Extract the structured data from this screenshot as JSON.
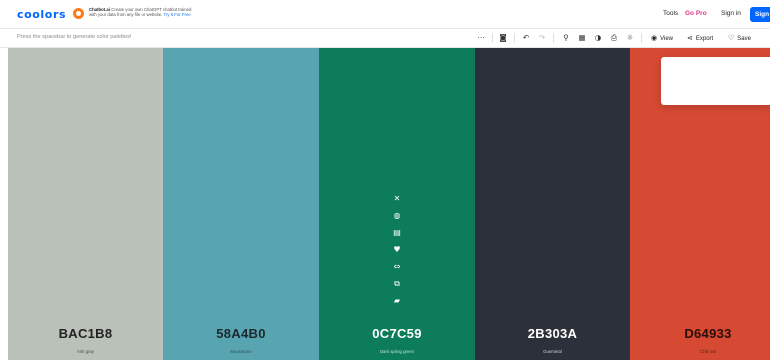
{
  "nav": {
    "logo": "coolors",
    "ad": {
      "brand": "Chatbot.ai",
      "line1": "Create your own ChatGPT chatbot trained",
      "line2": "with your data from any file or website.",
      "cta": "Try It For Free"
    },
    "tools": "Tools",
    "gopro": "Go Pro",
    "signin": "Sign in",
    "signup": "Sign up"
  },
  "toolbar": {
    "hint": "Press the spacebar to generate color palettes!",
    "icons": [
      "more-icon",
      "camera-icon",
      "undo-icon",
      "redo-icon",
      "adjust-icon",
      "grid-icon",
      "contrast-icon",
      "print-icon",
      "sun-icon"
    ],
    "view": "View",
    "export": "Export",
    "save": "Save"
  },
  "palette": {
    "swatches": [
      {
        "hex": "BAC1B8",
        "name": "Ash gray",
        "color": "#BAC1B8",
        "text": "#222222"
      },
      {
        "hex": "58A4B0",
        "name": "Moonstone",
        "color": "#58A4B0",
        "text": "#1a2a2e"
      },
      {
        "hex": "0C7C59",
        "name": "Dark spring green",
        "color": "#0C7C59",
        "text": "#ffffff"
      },
      {
        "hex": "2B303A",
        "name": "Gunmetal",
        "color": "#2B303A",
        "text": "#ffffff"
      },
      {
        "hex": "D64933",
        "name": "Chili red",
        "color": "#D64933",
        "text": "#2a0f0a"
      }
    ],
    "active_tools": [
      "close-icon",
      "contrast-icon",
      "shades-icon",
      "heart-icon",
      "drag-icon",
      "copy-icon",
      "lock-icon"
    ]
  }
}
